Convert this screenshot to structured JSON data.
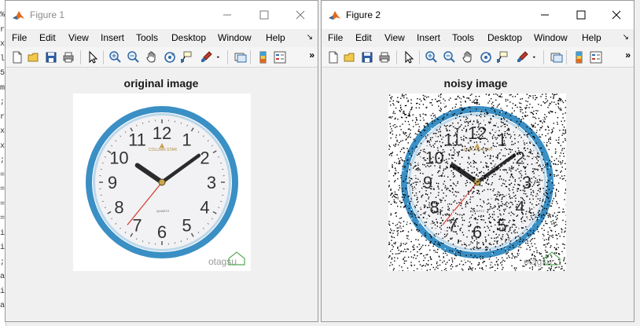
{
  "background_editor_glyphs": [
    "%",
    "r",
    "x",
    "l",
    "5",
    "m",
    ";",
    "r",
    "x",
    "x",
    ";",
    "=",
    "=",
    "=",
    "=",
    "i",
    "i",
    ";",
    "a",
    "i",
    "a"
  ],
  "windows": [
    {
      "title": "Figure 1",
      "menu": [
        "File",
        "Edit",
        "View",
        "Insert",
        "Tools",
        "Desktop",
        "Window",
        "Help"
      ],
      "axes_title": "original image",
      "image_watermark": "otagsu",
      "image_kind": "original"
    },
    {
      "title": "Figure 2",
      "menu": [
        "File",
        "Edit",
        "View",
        "Insert",
        "Tools",
        "Desktop",
        "Window",
        "Help"
      ],
      "axes_title": "noisy  image",
      "image_watermark": "otagsu",
      "image_kind": "noisy"
    }
  ],
  "toolbar_icons": [
    "new-figure-icon",
    "open-file-icon",
    "save-icon",
    "print-icon",
    "edit-plot-arrow-icon",
    "zoom-in-icon",
    "zoom-out-icon",
    "pan-hand-icon",
    "rotate-3d-icon",
    "data-cursor-icon",
    "brush-icon",
    "brush-dropdown-icon",
    "link-plot-icon",
    "colorbar-icon",
    "legend-icon"
  ],
  "colors": {
    "clock_ring": "#3a8fc4",
    "clock_face": "#f2f2f4",
    "second_hand": "#d03a2a",
    "hands": "#2b2b2b",
    "window_bg": "#f0f0f0",
    "matlab_orange": "#e06a1a"
  },
  "clock": {
    "numerals": [
      "12",
      "1",
      "2",
      "3",
      "4",
      "5",
      "6",
      "7",
      "8",
      "9",
      "10",
      "11"
    ],
    "hour_time": "10:09",
    "brand_text": "COLUMN STAR",
    "quartz_text": "QUARTZ"
  }
}
